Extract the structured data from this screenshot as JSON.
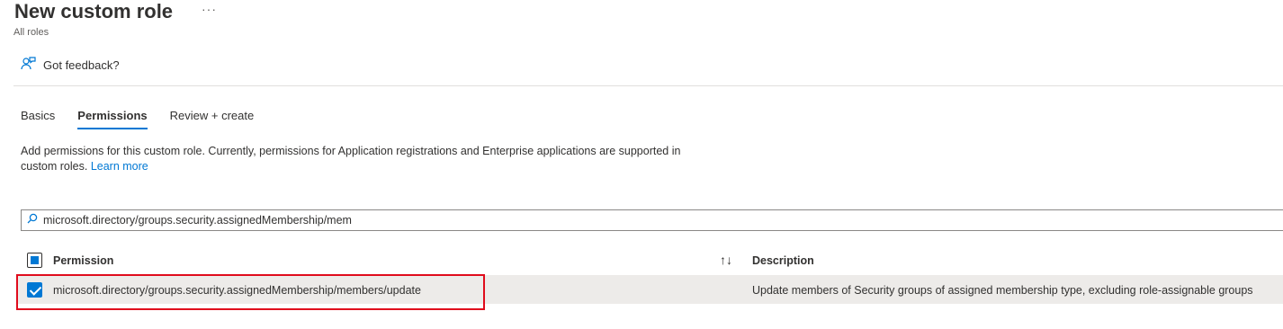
{
  "page": {
    "title": "New custom role",
    "more": "···",
    "breadcrumb": "All roles"
  },
  "feedback": {
    "label": "Got feedback?",
    "icon": "feedback-person-icon"
  },
  "tabs": [
    {
      "label": "Basics",
      "active": false
    },
    {
      "label": "Permissions",
      "active": true
    },
    {
      "label": "Review + create",
      "active": false
    }
  ],
  "description": {
    "text": "Add permissions for this custom role. Currently, permissions for Application registrations and Enterprise applications are supported in custom roles.",
    "link": "Learn more"
  },
  "search": {
    "value": "microsoft.directory/groups.security.assignedMembership/mem",
    "icon": "search-icon"
  },
  "table": {
    "columns": {
      "permission": "Permission",
      "sort_icon": "↑↓",
      "description": "Description"
    },
    "select_all_state": "partial",
    "rows": [
      {
        "selected": true,
        "permission": "microsoft.directory/groups.security.assignedMembership/members/update",
        "description": "Update members of Security groups of assigned membership type, excluding role-assignable groups"
      }
    ]
  },
  "colors": {
    "accent": "#0078d4",
    "highlight_border": "#e00b1c",
    "selected_row": "#edebe9"
  }
}
